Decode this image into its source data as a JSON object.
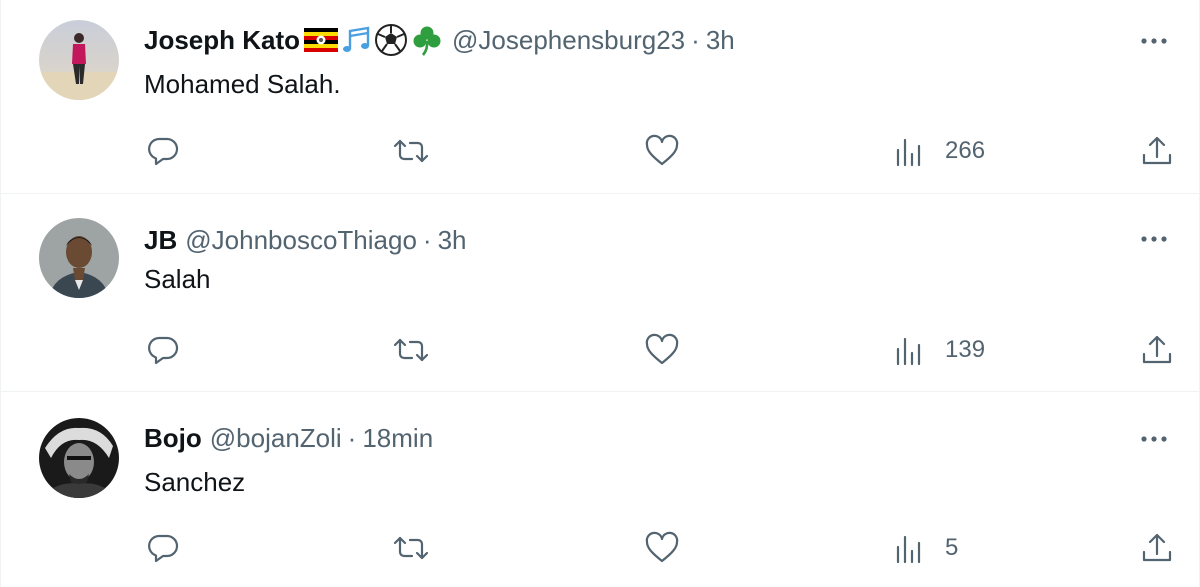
{
  "tweets": [
    {
      "name": "Joseph Kato",
      "emojis": [
        "uganda-flag-icon",
        "music-notes-icon",
        "soccer-ball-icon",
        "shamrock-icon"
      ],
      "handle": "@Josephensburg23",
      "separator": "·",
      "time": "3h",
      "text": "Mohamed Salah.",
      "views": "266"
    },
    {
      "name": "JB",
      "handle": "@JohnboscoThiago",
      "separator": "·",
      "time": "3h",
      "text": "Salah",
      "views": "139"
    },
    {
      "name": "Bojo",
      "handle": "@bojanZoli",
      "separator": "·",
      "time": "18min",
      "text": "Sanchez",
      "views": "5"
    }
  ],
  "colors": {
    "text_primary": "#0f1419",
    "text_secondary": "#536471",
    "divider": "#eff3f4",
    "uganda_flag": [
      "#000000",
      "#fcdc04",
      "#d90000"
    ],
    "music_notes": "#4a9fe0",
    "shamrock": "#2e9e3f"
  }
}
